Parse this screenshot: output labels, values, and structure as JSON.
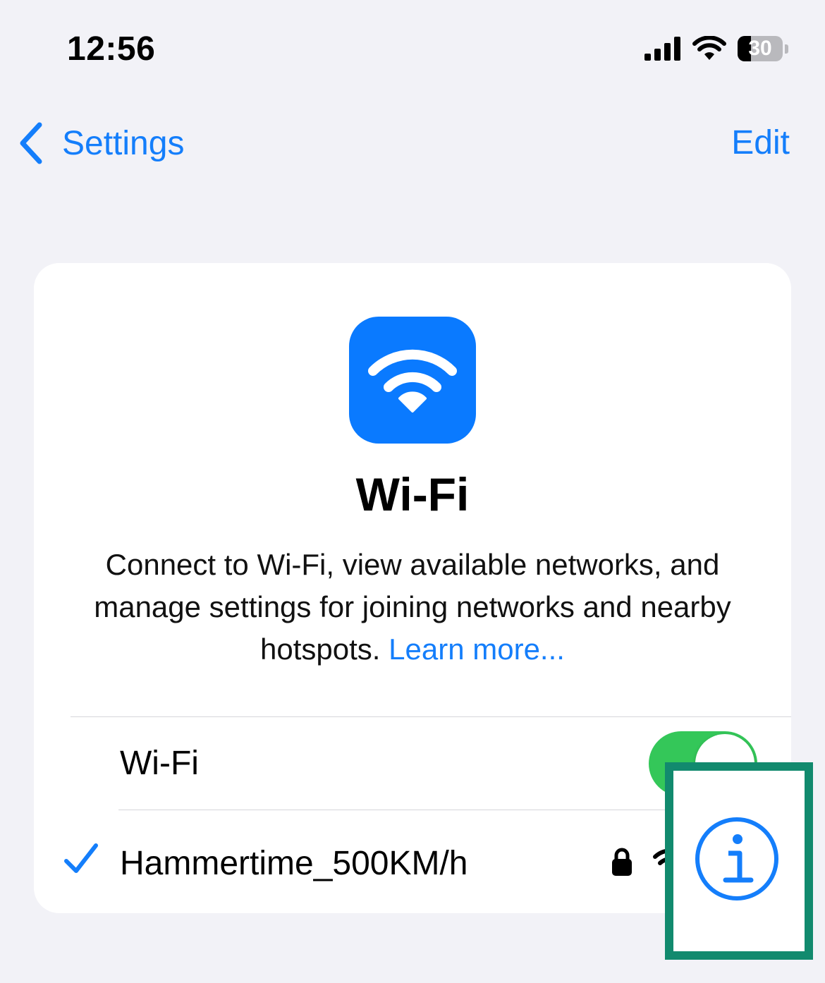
{
  "status_bar": {
    "time": "12:56",
    "battery_level": "30",
    "battery_fraction": 0.3
  },
  "nav": {
    "back_label": "Settings",
    "edit_label": "Edit"
  },
  "header": {
    "title": "Wi-Fi",
    "description": "Connect to Wi-Fi, view available networks, and manage settings for joining networks and nearby hotspots.",
    "learn_more": "Learn more..."
  },
  "wifi_row": {
    "label": "Wi-Fi",
    "enabled": true
  },
  "network": {
    "name": "Hammertime_500KM/h",
    "connected": true,
    "secured": true
  },
  "colors": {
    "accent": "#147efb",
    "toggle_on": "#34c759",
    "icon_bg": "#0a7aff",
    "highlight": "#128a6e",
    "background": "#f2f2f7"
  },
  "icons": {
    "back": "chevron-left-icon",
    "app": "wifi-icon",
    "check": "checkmark-icon",
    "lock": "lock-icon",
    "signal": "wifi-signal-icon",
    "info": "info-icon"
  }
}
